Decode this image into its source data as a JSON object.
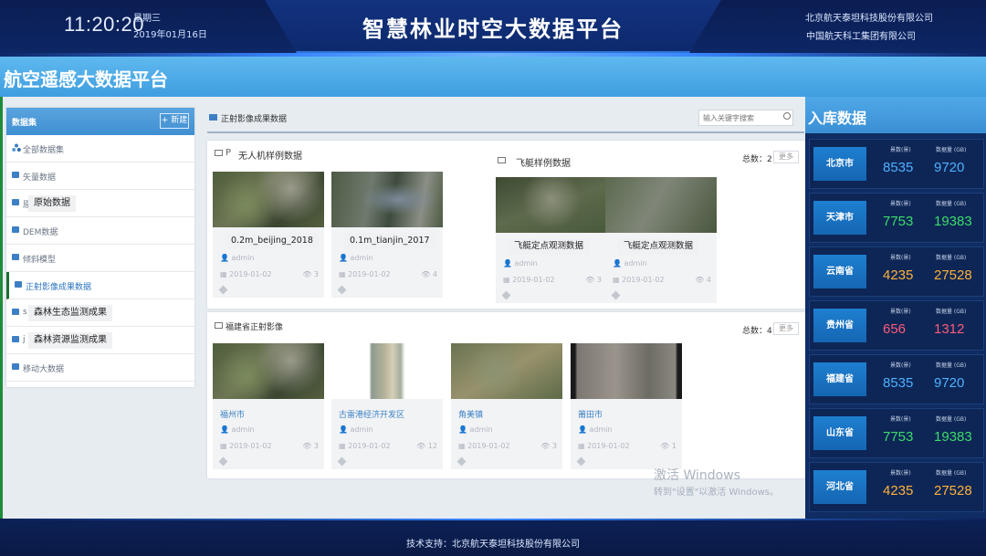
{
  "header": {
    "time": "11:20:20",
    "weekday": "星期三",
    "date": "2019年01月16日",
    "title": "智慧林业时空大数据平台",
    "company1": "北京航天泰坦科技股份有限公司",
    "company2": "中国航天科工集团有限公司"
  },
  "band": {
    "title": "航空遥感大数据平台"
  },
  "sidebar": {
    "title": "数据集",
    "new_button": "+ 新建",
    "items": [
      {
        "label": "全部数据集"
      },
      {
        "label": "矢量数据"
      },
      {
        "label": "原",
        "overlay": "原始数据"
      },
      {
        "label": "DEM数据"
      },
      {
        "label": "倾斜模型"
      },
      {
        "label": "正射影像成果数据"
      },
      {
        "label": "s",
        "overlay": "森林生态监测成果"
      },
      {
        "label": "j",
        "overlay": "森林资源监测成果"
      },
      {
        "label": "移动大数据"
      }
    ]
  },
  "content": {
    "title": "正射影像成果数据",
    "search_placeholder": "输入关键字搜索"
  },
  "groups": [
    {
      "title_prefix": "P",
      "title": "无人机样例数据",
      "cards": [
        {
          "name": "0.2m_beijing_2018",
          "author": "admin",
          "date": "2019-01-02",
          "views": "3"
        },
        {
          "name": "0.1m_tianjin_2017",
          "author": "admin",
          "date": "2019-01-02",
          "views": "4"
        }
      ]
    },
    {
      "title": "飞艇样例数据",
      "total_label": "总数：",
      "total": "2",
      "more": "更多",
      "cards": [
        {
          "name": "飞艇定点观测数据",
          "author": "admin",
          "date": "2019-01-02",
          "views": "3"
        },
        {
          "name": "飞艇定点观测数据",
          "author": "admin",
          "date": "2019-01-02",
          "views": "4"
        }
      ]
    },
    {
      "title": "福建省正射影像",
      "total_label": "总数：",
      "total": "4",
      "more": "更多",
      "cards": [
        {
          "name": "福州市",
          "author": "admin",
          "date": "2019-01-02",
          "views": "3"
        },
        {
          "name": "古雷港经济开发区",
          "author": "admin",
          "date": "2019-01-02",
          "views": "12"
        },
        {
          "name": "角美镇",
          "author": "admin",
          "date": "2019-01-02",
          "views": "3"
        },
        {
          "name": "莆田市",
          "author": "admin",
          "date": "2019-01-02",
          "views": "1"
        }
      ]
    }
  ],
  "watermark": {
    "line1": "激活 Windows",
    "line2": "转到\"设置\"以激活 Windows。"
  },
  "stats": {
    "title": "入库数据",
    "col1": "景数(景)",
    "col2": "数据量 (GB)",
    "rows": [
      {
        "province": "北京市",
        "count": "8535",
        "size": "9720",
        "color": "#4fb0ff"
      },
      {
        "province": "天津市",
        "count": "7753",
        "size": "19383",
        "color": "#3ddc6a"
      },
      {
        "province": "云南省",
        "count": "4235",
        "size": "27528",
        "color": "#ffb23a"
      },
      {
        "province": "贵州省",
        "count": "656",
        "size": "1312",
        "color": "#ff5a7a"
      },
      {
        "province": "福建省",
        "count": "8535",
        "size": "9720",
        "color": "#4fb0ff"
      },
      {
        "province": "山东省",
        "count": "7753",
        "size": "19383",
        "color": "#3ddc6a"
      },
      {
        "province": "河北省",
        "count": "4235",
        "size": "27528",
        "color": "#ffb23a"
      }
    ]
  },
  "footer": {
    "text": "技术支持：北京航天泰坦科技股份有限公司"
  }
}
